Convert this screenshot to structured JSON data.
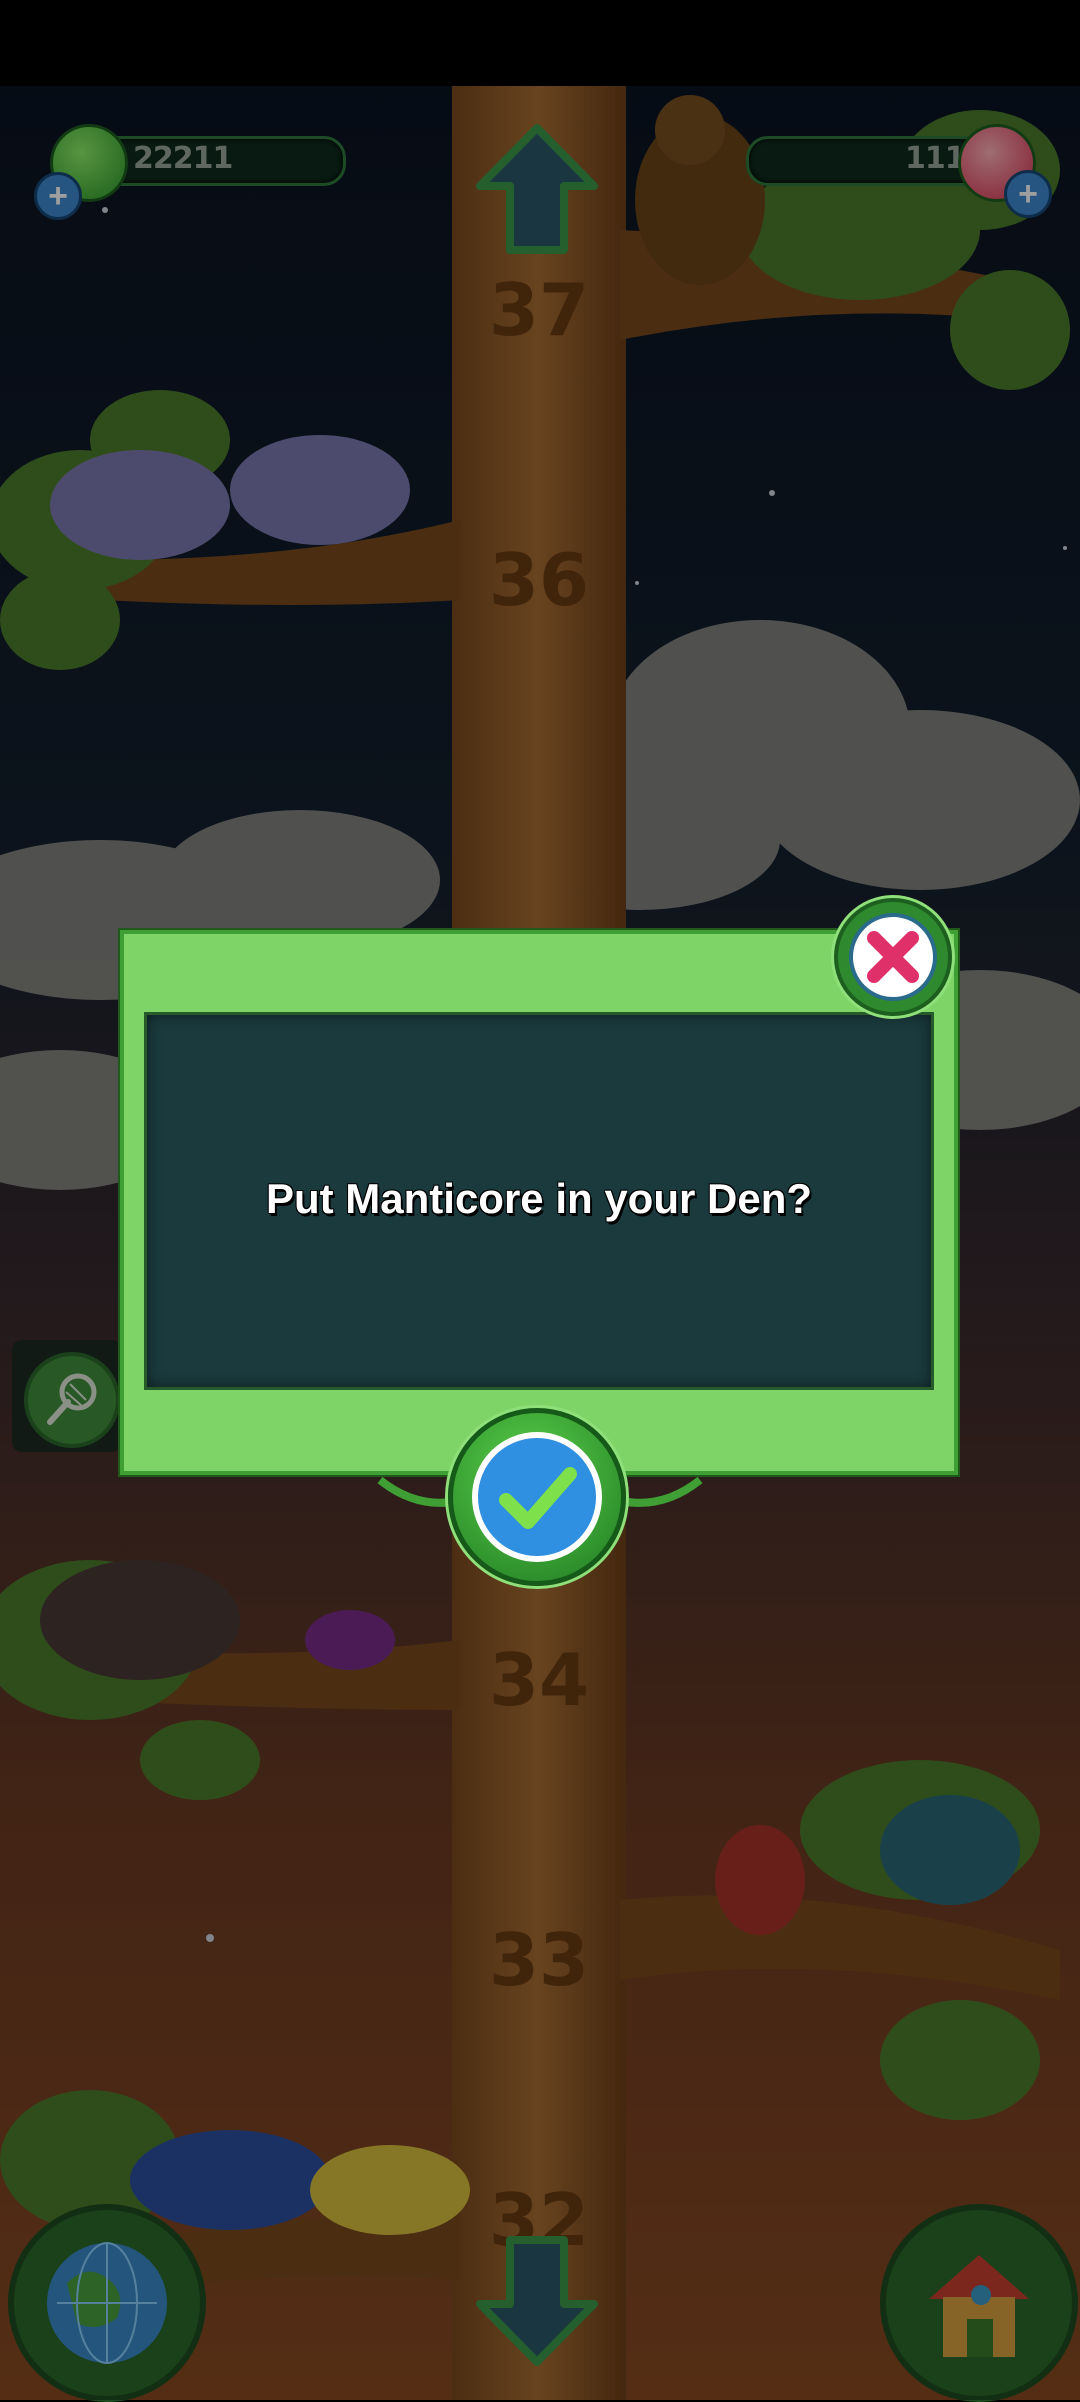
{
  "hud": {
    "currency_left": "22211",
    "currency_right": "111"
  },
  "tree": {
    "branch_numbers": [
      "37",
      "36",
      "34",
      "33",
      "32"
    ]
  },
  "dialog": {
    "message": "Put Manticore in your Den?"
  },
  "icons": {
    "left_currency": "green-gem-icon",
    "right_currency": "red-flower-gem-icon",
    "add": "plus-icon",
    "up": "up-arrow-icon",
    "down": "down-arrow-icon",
    "net": "net-icon",
    "close": "close-icon",
    "confirm": "checkmark-icon",
    "world": "globe-icon",
    "den": "house-icon"
  },
  "colors": {
    "panel_green": "#7fd467",
    "panel_dark": "#1a3a3d",
    "close_pink": "#e0306a",
    "confirm_blue": "#2f8fe0"
  }
}
